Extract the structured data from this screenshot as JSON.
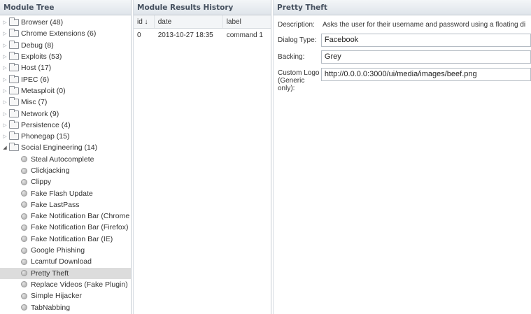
{
  "tree": {
    "title": "Module Tree",
    "items": [
      {
        "label": "Browser (48)",
        "kind": "folder",
        "expanded": false
      },
      {
        "label": "Chrome Extensions (6)",
        "kind": "folder",
        "expanded": false
      },
      {
        "label": "Debug (8)",
        "kind": "folder",
        "expanded": false
      },
      {
        "label": "Exploits (53)",
        "kind": "folder",
        "expanded": false
      },
      {
        "label": "Host (17)",
        "kind": "folder",
        "expanded": false
      },
      {
        "label": "IPEC (6)",
        "kind": "folder",
        "expanded": false
      },
      {
        "label": "Metasploit (0)",
        "kind": "folder",
        "expanded": false
      },
      {
        "label": "Misc (7)",
        "kind": "folder",
        "expanded": false
      },
      {
        "label": "Network (9)",
        "kind": "folder",
        "expanded": false
      },
      {
        "label": "Persistence (4)",
        "kind": "folder",
        "expanded": false
      },
      {
        "label": "Phonegap (15)",
        "kind": "folder",
        "expanded": false
      },
      {
        "label": "Social Engineering (14)",
        "kind": "folder",
        "expanded": true
      },
      {
        "label": "Steal Autocomplete",
        "kind": "leaf"
      },
      {
        "label": "Clickjacking",
        "kind": "leaf"
      },
      {
        "label": "Clippy",
        "kind": "leaf"
      },
      {
        "label": "Fake Flash Update",
        "kind": "leaf"
      },
      {
        "label": "Fake LastPass",
        "kind": "leaf"
      },
      {
        "label": "Fake Notification Bar (Chrome",
        "kind": "leaf"
      },
      {
        "label": "Fake Notification Bar (Firefox)",
        "kind": "leaf"
      },
      {
        "label": "Fake Notification Bar (IE)",
        "kind": "leaf"
      },
      {
        "label": "Google Phishing",
        "kind": "leaf"
      },
      {
        "label": "Lcamtuf Download",
        "kind": "leaf"
      },
      {
        "label": "Pretty Theft",
        "kind": "leaf",
        "selected": true
      },
      {
        "label": "Replace Videos (Fake Plugin)",
        "kind": "leaf"
      },
      {
        "label": "Simple Hijacker",
        "kind": "leaf"
      },
      {
        "label": "TabNabbing",
        "kind": "leaf"
      }
    ]
  },
  "history": {
    "title": "Module Results History",
    "columns": {
      "id": "id ↓",
      "date": "date",
      "label": "label"
    },
    "rows": [
      {
        "id": "0",
        "date": "2013-10-27 18:35",
        "label": "command 1"
      }
    ]
  },
  "detail": {
    "title": "Pretty Theft",
    "description_label": "Description:",
    "description_value": "Asks the user for their username and password using a floating di",
    "dialog_type_label": "Dialog Type:",
    "dialog_type_value": "Facebook",
    "backing_label": "Backing:",
    "backing_value": "Grey",
    "logo_label": "Custom Logo (Generic only):",
    "logo_value": "http://0.0.0.0:3000/ui/media/images/beef.png"
  },
  "icons": {
    "collapsed": "triangle-right-icon",
    "expanded": "triangle-down-icon",
    "folder": "folder-icon",
    "leaf": "module-dot-icon"
  }
}
